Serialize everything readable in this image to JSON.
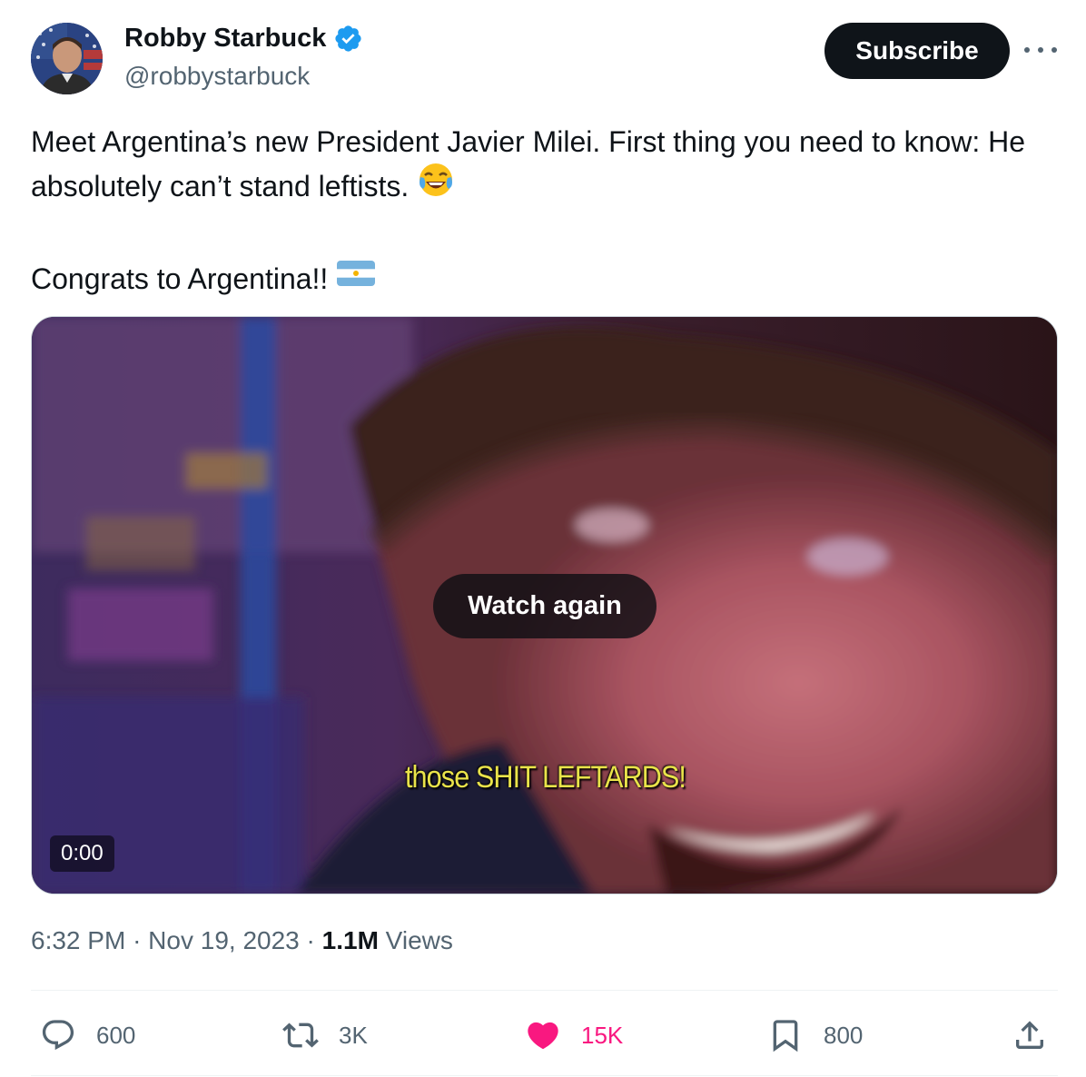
{
  "author": {
    "display_name": "Robby Starbuck",
    "handle": "@robbystarbuck",
    "verified": true,
    "verified_color": "#1d9bf0"
  },
  "header": {
    "subscribe_label": "Subscribe",
    "more_icon": "more-horizontal-icon"
  },
  "tweet": {
    "line1_text": "Meet Argentina’s new President Javier Milei. First thing you need to know: He absolutely can’t stand leftists.",
    "line1_emoji": "face-with-tears-of-joy-emoji",
    "line2_text": "Congrats to Argentina!!",
    "line2_emoji": "flag-argentina-emoji"
  },
  "media": {
    "type": "video",
    "overlay_button_label": "Watch again",
    "subtitle": "those SHIT LEFTARDS!",
    "timecode": "0:00"
  },
  "meta": {
    "time": "6:32 PM",
    "separator": "·",
    "date": "Nov 19, 2023",
    "views_count": "1.1M",
    "views_label": "Views"
  },
  "actions": {
    "replies": "600",
    "reposts": "3K",
    "likes": "15K",
    "liked": true,
    "like_color": "#f91880",
    "bookmarks": "800"
  }
}
